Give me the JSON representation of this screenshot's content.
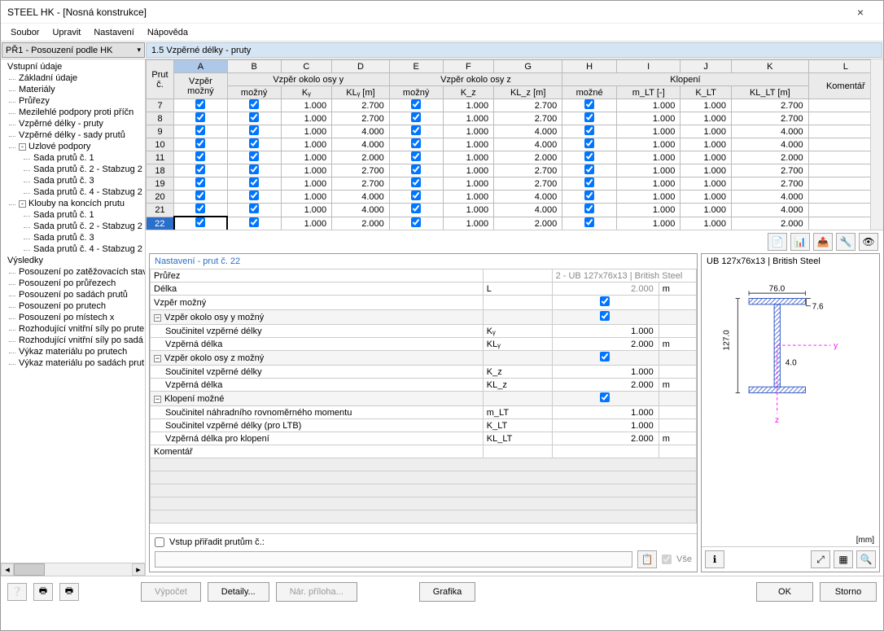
{
  "window": {
    "title": "STEEL HK - [Nosná konstrukce]",
    "close": "×"
  },
  "menu": [
    "Soubor",
    "Upravit",
    "Nastavení",
    "Nápověda"
  ],
  "caseCombo": "PŘ1 - Posouzení podle HK",
  "paneTitle": "1.5 Vzpěrné délky - pruty",
  "tree": [
    {
      "lvl": 1,
      "txt": "Vstupní údaje"
    },
    {
      "lvl": 2,
      "txt": "Základní údaje"
    },
    {
      "lvl": 2,
      "txt": "Materiály"
    },
    {
      "lvl": 2,
      "txt": "Průřezy"
    },
    {
      "lvl": 2,
      "txt": "Mezilehlé podpory proti příčn"
    },
    {
      "lvl": 2,
      "txt": "Vzpěrné délky - pruty"
    },
    {
      "lvl": 2,
      "txt": "Vzpěrné délky - sady prutů"
    },
    {
      "lvl": 2,
      "txt": "Uzlové podpory",
      "exp": "-"
    },
    {
      "lvl": 3,
      "txt": "Sada prutů č. 1"
    },
    {
      "lvl": 3,
      "txt": "Sada prutů č. 2 - Stabzug 2"
    },
    {
      "lvl": 3,
      "txt": "Sada prutů č. 3"
    },
    {
      "lvl": 3,
      "txt": "Sada prutů č. 4 - Stabzug 2"
    },
    {
      "lvl": 2,
      "txt": "Klouby na koncích prutu",
      "exp": "-"
    },
    {
      "lvl": 3,
      "txt": "Sada prutů č. 1"
    },
    {
      "lvl": 3,
      "txt": "Sada prutů č. 2 - Stabzug 2"
    },
    {
      "lvl": 3,
      "txt": "Sada prutů č. 3"
    },
    {
      "lvl": 3,
      "txt": "Sada prutů č. 4 - Stabzug 2"
    },
    {
      "lvl": 1,
      "txt": "Výsledky"
    },
    {
      "lvl": 2,
      "txt": "Posouzení po zatěžovacích stav"
    },
    {
      "lvl": 2,
      "txt": "Posouzení po průřezech"
    },
    {
      "lvl": 2,
      "txt": "Posouzení po sadách prutů"
    },
    {
      "lvl": 2,
      "txt": "Posouzení po prutech"
    },
    {
      "lvl": 2,
      "txt": "Posouzení po místech x"
    },
    {
      "lvl": 2,
      "txt": "Rozhodující vnitřní síly po prute"
    },
    {
      "lvl": 2,
      "txt": "Rozhodující vnitřní síly po sadá"
    },
    {
      "lvl": 2,
      "txt": "Výkaz materiálu po prutech"
    },
    {
      "lvl": 2,
      "txt": "Výkaz materiálu po sadách prut"
    }
  ],
  "grid": {
    "letters": [
      "A",
      "B",
      "C",
      "D",
      "E",
      "F",
      "G",
      "H",
      "I",
      "J",
      "K",
      "L"
    ],
    "groups": {
      "prut": "Prut\nč.",
      "vm": "Vzpěr\nmožný",
      "gy": "Vzpěr okolo osy y",
      "gz": "Vzpěr okolo osy z",
      "gk": "Klopení",
      "kom": "Komentář"
    },
    "subs": {
      "mozny": "možný",
      "ky": "Kᵧ",
      "kly": "KLᵧ [m]",
      "kz": "K_z",
      "klz": "KL_z [m]",
      "mozne": "možné",
      "mlt": "m_LT [-]",
      "klt": "K_LT",
      "kllt": "KL_LT [m]"
    },
    "rows": [
      {
        "n": 7,
        "ky": "1.000",
        "kly": "2.700",
        "kz": "1.000",
        "klz": "2.700",
        "mlt": "1.000",
        "klt": "1.000",
        "kllt": "2.700"
      },
      {
        "n": 8,
        "ky": "1.000",
        "kly": "2.700",
        "kz": "1.000",
        "klz": "2.700",
        "mlt": "1.000",
        "klt": "1.000",
        "kllt": "2.700"
      },
      {
        "n": 9,
        "ky": "1.000",
        "kly": "4.000",
        "kz": "1.000",
        "klz": "4.000",
        "mlt": "1.000",
        "klt": "1.000",
        "kllt": "4.000"
      },
      {
        "n": 10,
        "ky": "1.000",
        "kly": "4.000",
        "kz": "1.000",
        "klz": "4.000",
        "mlt": "1.000",
        "klt": "1.000",
        "kllt": "4.000"
      },
      {
        "n": 11,
        "ky": "1.000",
        "kly": "2.000",
        "kz": "1.000",
        "klz": "2.000",
        "mlt": "1.000",
        "klt": "1.000",
        "kllt": "2.000"
      },
      {
        "n": 18,
        "ky": "1.000",
        "kly": "2.700",
        "kz": "1.000",
        "klz": "2.700",
        "mlt": "1.000",
        "klt": "1.000",
        "kllt": "2.700"
      },
      {
        "n": 19,
        "ky": "1.000",
        "kly": "2.700",
        "kz": "1.000",
        "klz": "2.700",
        "mlt": "1.000",
        "klt": "1.000",
        "kllt": "2.700"
      },
      {
        "n": 20,
        "ky": "1.000",
        "kly": "4.000",
        "kz": "1.000",
        "klz": "4.000",
        "mlt": "1.000",
        "klt": "1.000",
        "kllt": "4.000"
      },
      {
        "n": 21,
        "ky": "1.000",
        "kly": "4.000",
        "kz": "1.000",
        "klz": "4.000",
        "mlt": "1.000",
        "klt": "1.000",
        "kllt": "4.000"
      },
      {
        "n": 22,
        "ky": "1.000",
        "kly": "2.000",
        "kz": "1.000",
        "klz": "2.000",
        "mlt": "1.000",
        "klt": "1.000",
        "kllt": "2.000",
        "sel": true
      }
    ]
  },
  "detail": {
    "title": "Nastavení - prut č. 22",
    "rows": [
      {
        "t": "plain",
        "lbl": "Průřez",
        "val": "2 - UB 127x76x13 | British Steel",
        "grey": true,
        "span": true
      },
      {
        "t": "plain",
        "lbl": "Délka",
        "sym": "L",
        "val": "2.000",
        "unit": "m",
        "grey": true
      },
      {
        "t": "plain",
        "lbl": "Vzpěr možný",
        "chk": true
      },
      {
        "t": "group",
        "lbl": "Vzpěr okolo osy y možný",
        "chk": true
      },
      {
        "t": "sub",
        "lbl": "Součinitel vzpěrné délky",
        "sym": "Kᵧ",
        "val": "1.000"
      },
      {
        "t": "sub",
        "lbl": "Vzpěrná délka",
        "sym": "KLᵧ",
        "val": "2.000",
        "unit": "m"
      },
      {
        "t": "group",
        "lbl": "Vzpěr okolo osy z možný",
        "chk": true
      },
      {
        "t": "sub",
        "lbl": "Součinitel vzpěrné délky",
        "sym": "K_z",
        "val": "1.000"
      },
      {
        "t": "sub",
        "lbl": "Vzpěrná délka",
        "sym": "KL_z",
        "val": "2.000",
        "unit": "m"
      },
      {
        "t": "group",
        "lbl": "Klopení možné",
        "chk": true
      },
      {
        "t": "sub",
        "lbl": "Součinitel náhradního rovnoměrného momentu",
        "sym": "m_LT",
        "val": "1.000"
      },
      {
        "t": "sub",
        "lbl": "Součinitel vzpěrné délky (pro LTB)",
        "sym": "K_LT",
        "val": "1.000"
      },
      {
        "t": "sub",
        "lbl": "Vzpěrná délka pro klopení",
        "sym": "KL_LT",
        "val": "2.000",
        "unit": "m"
      },
      {
        "t": "plain",
        "lbl": "Komentář"
      }
    ],
    "assign": {
      "chk": "Vstup přiřadit prutům č.:",
      "all": "Vše"
    }
  },
  "section": {
    "title": "UB 127x76x13 | British Steel",
    "unit": "[mm]",
    "dims": {
      "w": "76.0",
      "h": "127.0",
      "tf": "7.6",
      "tw": "4.0"
    }
  },
  "footer": {
    "vypocet": "Výpočet",
    "detaily": "Detaily...",
    "nar": "Nár. příloha...",
    "grafika": "Grafika",
    "ok": "OK",
    "storno": "Storno"
  }
}
